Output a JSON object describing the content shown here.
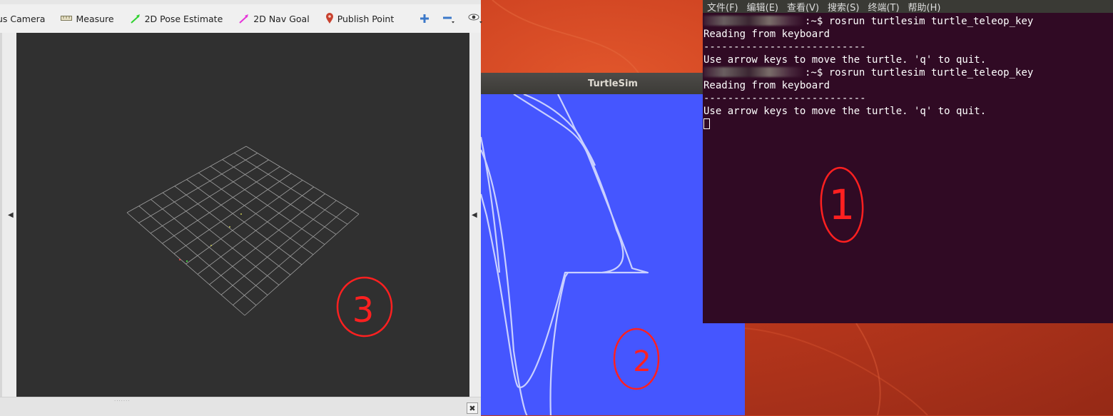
{
  "rviz": {
    "toolbar": {
      "focus_camera": "us Camera",
      "measure": "Measure",
      "pose_estimate": "2D Pose Estimate",
      "nav_goal": "2D Nav Goal",
      "publish_point": "Publish Point"
    },
    "close_label": "✖"
  },
  "turtlesim": {
    "title": "TurtleSim",
    "background_color": "#4556ff",
    "trail_color": "#c9d0ff"
  },
  "terminal": {
    "menu": [
      "文件(F)",
      "编辑(E)",
      "查看(V)",
      "搜索(S)",
      "终端(T)",
      "帮助(H)"
    ],
    "lines": [
      {
        "prompt_suffix": ":~$ ",
        "command": "rosrun turtlesim turtle_teleop_key"
      },
      {
        "text": "Reading from keyboard"
      },
      {
        "text": "---------------------------"
      },
      {
        "text": "Use arrow keys to move the turtle. 'q' to quit."
      },
      {
        "prompt_suffix": ":~$ ",
        "command": "rosrun turtlesim turtle_teleop_key"
      },
      {
        "text": "Reading from keyboard"
      },
      {
        "text": "---------------------------"
      },
      {
        "text": "Use arrow keys to move the turtle. 'q' to quit."
      }
    ],
    "background_color": "#300a24"
  },
  "annotations": {
    "terminal_mark": "1",
    "turtlesim_mark": "2",
    "rviz_mark": "3",
    "color": "#ff2020"
  }
}
